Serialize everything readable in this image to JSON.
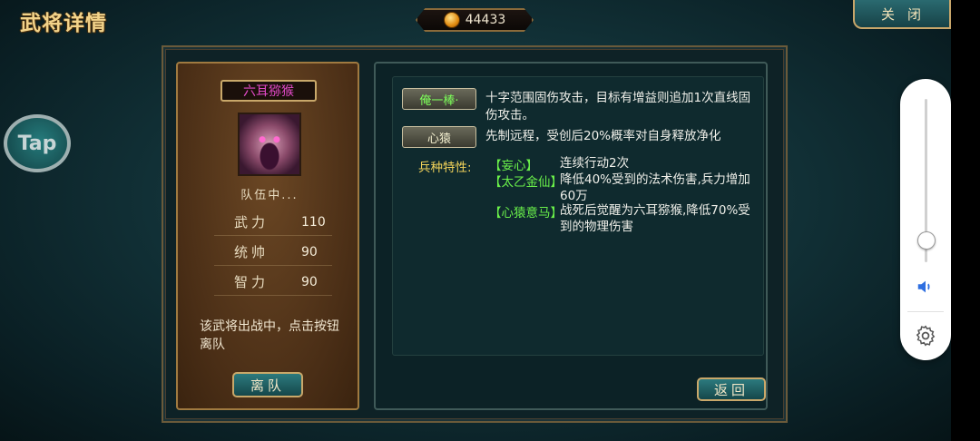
{
  "header": {
    "title": "武将详情",
    "gold": "44433",
    "close_label": "关闭"
  },
  "overlay": {
    "tap_label": "Tap"
  },
  "general": {
    "name": "六耳猕猴",
    "status": "队伍中...",
    "stats": [
      {
        "label": "武力",
        "value": "110"
      },
      {
        "label": "统帅",
        "value": "90"
      },
      {
        "label": "智力",
        "value": "90"
      }
    ],
    "info": "该武将出战中，点击按钮离队",
    "leave_label": "离队"
  },
  "skills": [
    {
      "name": "俺一棒·",
      "desc": "十字范围固伤攻击，目标有增益则追加1次直线固伤攻击。"
    },
    {
      "name": "心猿",
      "desc": "先制远程，受创后20%概率对自身释放净化"
    }
  ],
  "traits": {
    "heading": "兵种特性:",
    "items": [
      {
        "name": "【妄心】",
        "desc": "连续行动2次"
      },
      {
        "name": "【太乙金仙】",
        "desc": "降低40%受到的法术伤害,兵力增加60万"
      },
      {
        "name": "【心猿意马】",
        "desc": "战死后觉醒为六耳猕猴,降低70%受到的物理伤害"
      }
    ]
  },
  "back_label": "返回",
  "volume": {
    "level": 0.0
  },
  "colors": {
    "name_magenta": "#e14ac8",
    "trait_green": "#6af04a",
    "trait_heading": "#f2d35a",
    "gold_title": "#f2d38a"
  }
}
